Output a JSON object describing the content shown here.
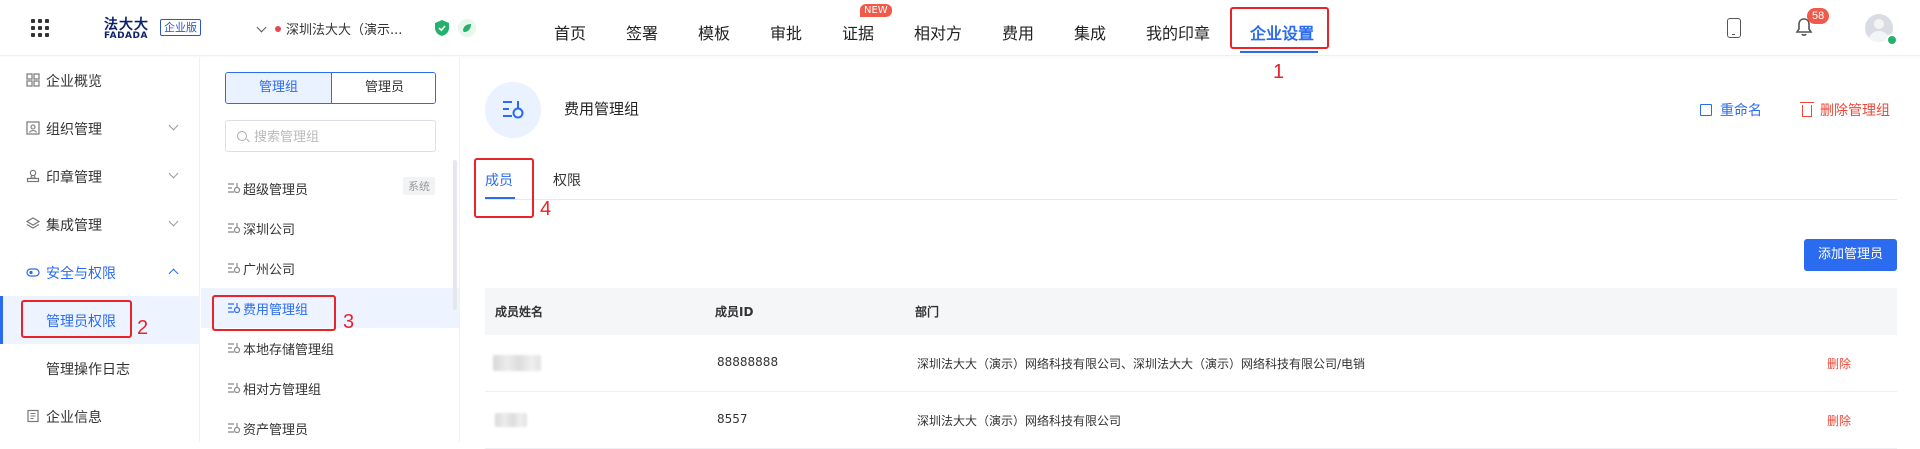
{
  "topbar": {
    "logo_main": "法大大",
    "logo_sub": "FADADA",
    "logo_badge": "企业版",
    "company": "深圳法大大（演示...",
    "nav": [
      "首页",
      "签署",
      "模板",
      "审批",
      "证据",
      "相对方",
      "费用",
      "集成",
      "我的印章",
      "企业设置"
    ],
    "nav_new_badge": "NEW",
    "notification_count": "58"
  },
  "sidebar": {
    "items": [
      {
        "label": "企业概览",
        "icon": "overview-icon"
      },
      {
        "label": "组织管理",
        "icon": "org-icon"
      },
      {
        "label": "印章管理",
        "icon": "seal-icon"
      },
      {
        "label": "集成管理",
        "icon": "layers-icon"
      },
      {
        "label": "安全与权限",
        "icon": "security-icon"
      }
    ],
    "sub_items": [
      "管理员权限",
      "管理操作日志"
    ],
    "bottom": {
      "label": "企业信息",
      "icon": "building-icon"
    }
  },
  "group_panel": {
    "segment": [
      "管理组",
      "管理员"
    ],
    "search_placeholder": "搜索管理组",
    "groups": [
      {
        "label": "超级管理员",
        "tag": "系统"
      },
      {
        "label": "深圳公司"
      },
      {
        "label": "广州公司"
      },
      {
        "label": "费用管理组"
      },
      {
        "label": "本地存储管理组"
      },
      {
        "label": "相对方管理组"
      },
      {
        "label": "资产管理员"
      }
    ]
  },
  "main": {
    "title": "费用管理组",
    "rename": "重命名",
    "delete_group": "删除管理组",
    "tabs": [
      "成员",
      "权限"
    ],
    "add_button": "添加管理员",
    "columns": [
      "成员姓名",
      "成员ID",
      "部门"
    ],
    "rows": [
      {
        "member_id": "88888888",
        "department": "深圳法大大（演示）网络科技有限公司、深圳法大大（演示）网络科技有限公司/电销",
        "action": "删除"
      },
      {
        "member_id": "8557",
        "department": "深圳法大大（演示）网络科技有限公司",
        "action": "删除"
      }
    ]
  },
  "annotations": [
    "1",
    "2",
    "3",
    "4"
  ],
  "colors": {
    "accent": "#2a6bf0",
    "danger": "#e8493a",
    "annotation": "#e8232a"
  }
}
